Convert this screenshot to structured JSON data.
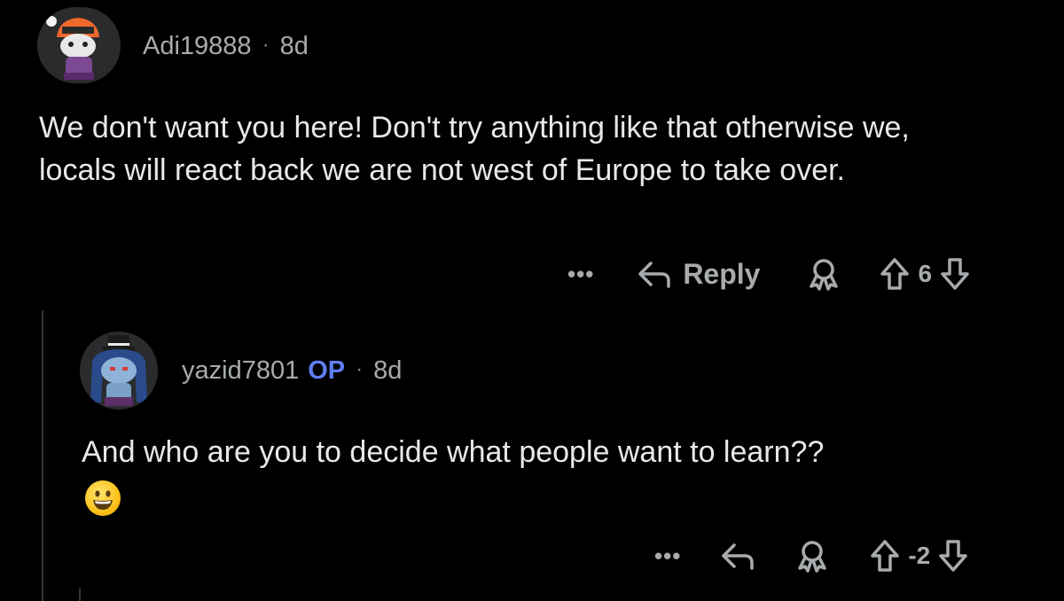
{
  "comments": [
    {
      "username": "Adi19888",
      "age": "8d",
      "body": "We don't want you here! Don't try anything like that otherwise we, locals will react back we are not west of Europe to take over.",
      "actions": {
        "more": "•••",
        "reply_label": "Reply",
        "score": "6"
      }
    },
    {
      "username": "yazid7801",
      "op_badge": "OP",
      "age": "8d",
      "body": "And who are you to decide what people want to learn??",
      "emoji": "grinning-face",
      "actions": {
        "more": "•••",
        "score": "-2"
      }
    }
  ],
  "separator": "·",
  "colors": {
    "background": "#000000",
    "op_accent": "#5f7ef0",
    "muted": "#a7abad",
    "text": "#e6e8ea"
  }
}
